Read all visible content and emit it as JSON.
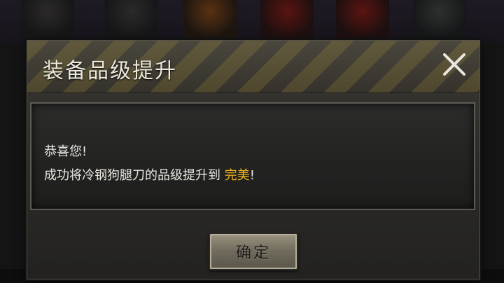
{
  "dialog": {
    "title": "装备品级提升",
    "close_icon": "close-icon"
  },
  "message": {
    "line1": "恭喜您!",
    "line2_prefix": "成功将冷钢狗腿刀的品级提升到",
    "line2_highlight": "完美",
    "line2_suffix": "!"
  },
  "buttons": {
    "confirm_label": "确定"
  },
  "colors": {
    "highlight": "#f0b41e",
    "text": "#e9e7e0",
    "title": "#ece8dc"
  }
}
